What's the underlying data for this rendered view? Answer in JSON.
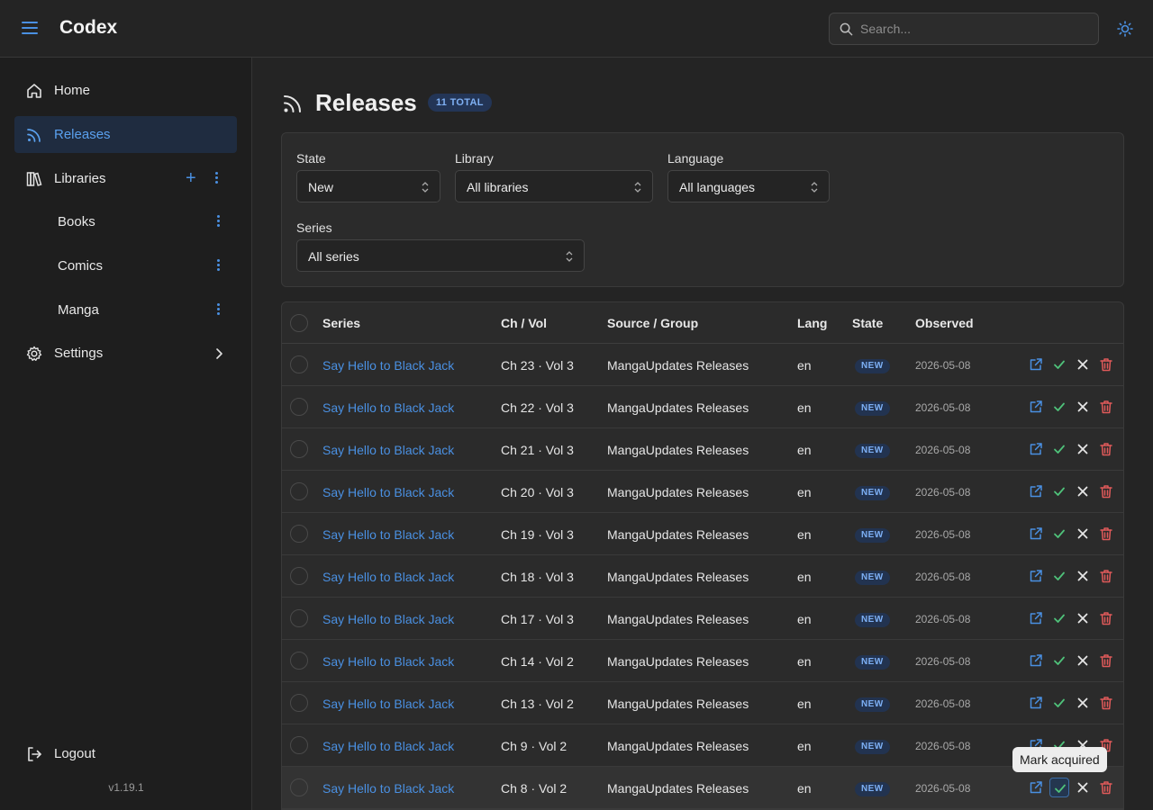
{
  "header": {
    "app_title": "Codex",
    "search_placeholder": "Search..."
  },
  "sidebar": {
    "items": [
      {
        "label": "Home",
        "icon": "home-icon"
      },
      {
        "label": "Releases",
        "icon": "rss-icon",
        "active": true
      },
      {
        "label": "Libraries",
        "icon": "library-icon"
      },
      {
        "label": "Books"
      },
      {
        "label": "Comics"
      },
      {
        "label": "Manga"
      },
      {
        "label": "Settings",
        "icon": "gear-icon"
      }
    ],
    "logout_label": "Logout",
    "version": "v1.19.1"
  },
  "main": {
    "title": "Releases",
    "total_badge": "11 TOTAL"
  },
  "filters": {
    "state": {
      "label": "State",
      "value": "New"
    },
    "library": {
      "label": "Library",
      "value": "All libraries"
    },
    "language": {
      "label": "Language",
      "value": "All languages"
    },
    "series": {
      "label": "Series",
      "value": "All series"
    }
  },
  "table": {
    "headers": [
      "Series",
      "Ch / Vol",
      "Source / Group",
      "Lang",
      "State",
      "Observed"
    ],
    "rows": [
      {
        "series": "Say Hello to Black Jack",
        "chvol": "Ch 23 · Vol 3",
        "source": "MangaUpdates Releases",
        "lang": "en",
        "state": "NEW",
        "observed": "2026-05-08"
      },
      {
        "series": "Say Hello to Black Jack",
        "chvol": "Ch 22 · Vol 3",
        "source": "MangaUpdates Releases",
        "lang": "en",
        "state": "NEW",
        "observed": "2026-05-08"
      },
      {
        "series": "Say Hello to Black Jack",
        "chvol": "Ch 21 · Vol 3",
        "source": "MangaUpdates Releases",
        "lang": "en",
        "state": "NEW",
        "observed": "2026-05-08"
      },
      {
        "series": "Say Hello to Black Jack",
        "chvol": "Ch 20 · Vol 3",
        "source": "MangaUpdates Releases",
        "lang": "en",
        "state": "NEW",
        "observed": "2026-05-08"
      },
      {
        "series": "Say Hello to Black Jack",
        "chvol": "Ch 19 · Vol 3",
        "source": "MangaUpdates Releases",
        "lang": "en",
        "state": "NEW",
        "observed": "2026-05-08"
      },
      {
        "series": "Say Hello to Black Jack",
        "chvol": "Ch 18 · Vol 3",
        "source": "MangaUpdates Releases",
        "lang": "en",
        "state": "NEW",
        "observed": "2026-05-08"
      },
      {
        "series": "Say Hello to Black Jack",
        "chvol": "Ch 17 · Vol 3",
        "source": "MangaUpdates Releases",
        "lang": "en",
        "state": "NEW",
        "observed": "2026-05-08"
      },
      {
        "series": "Say Hello to Black Jack",
        "chvol": "Ch 14 · Vol 2",
        "source": "MangaUpdates Releases",
        "lang": "en",
        "state": "NEW",
        "observed": "2026-05-08"
      },
      {
        "series": "Say Hello to Black Jack",
        "chvol": "Ch 13 · Vol 2",
        "source": "MangaUpdates Releases",
        "lang": "en",
        "state": "NEW",
        "observed": "2026-05-08"
      },
      {
        "series": "Say Hello to Black Jack",
        "chvol": "Ch 9 · Vol 2",
        "source": "MangaUpdates Releases",
        "lang": "en",
        "state": "NEW",
        "observed": "2026-05-08"
      },
      {
        "series": "Say Hello to Black Jack",
        "chvol": "Ch 8 · Vol 2",
        "source": "MangaUpdates Releases",
        "lang": "en",
        "state": "NEW",
        "observed": "2026-05-08"
      }
    ],
    "row_actions": [
      "external-link-icon",
      "check-icon",
      "close-icon",
      "trash-icon"
    ]
  },
  "tooltip": {
    "text": "Mark acquired"
  },
  "colors": {
    "accent": "#4a90e2",
    "acquire": "#4fc27a",
    "delete": "#e05a5a",
    "badge_bg": "#223350",
    "badge_text": "#7db0f5"
  }
}
